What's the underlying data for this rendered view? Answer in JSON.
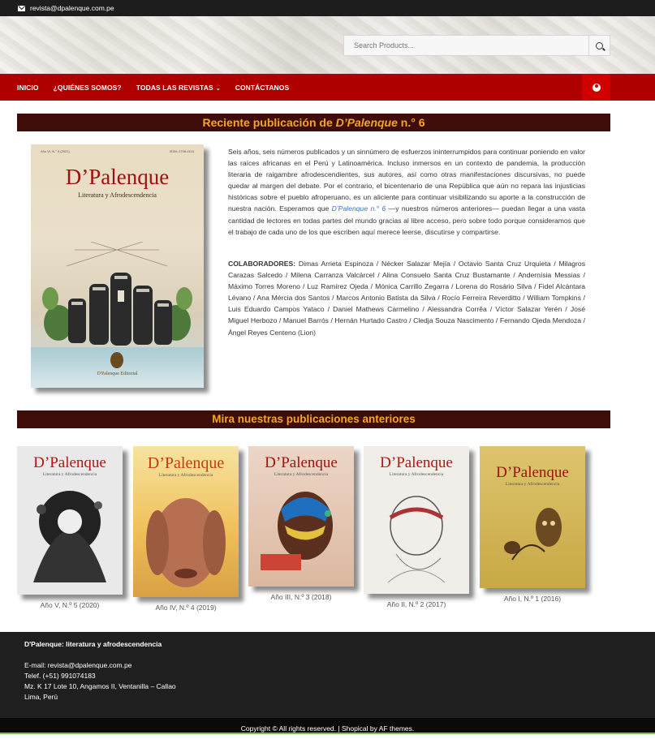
{
  "topbar": {
    "email": "revista@dpalenque.com.pe"
  },
  "search": {
    "placeholder": "Search Products..."
  },
  "nav": {
    "items": [
      "INICIO",
      "¿QUIÉNES SOMOS?",
      "TODAS LAS REVISTAS",
      "CONTÁCTANOS"
    ],
    "chevron": "⌄"
  },
  "recent": {
    "title_pre": "Reciente publicación de ",
    "title_em": "D’Palenque",
    "title_post": " n.° 6",
    "cover": {
      "issue": "Año VI, N.° 6 (2021)",
      "issn": "ISSN: 2708-4116",
      "name": "D’Palenque",
      "subtitle": "Literatura y Afrodescendencia",
      "publisher": "D'Palenque Editorial"
    },
    "description_1": "Seis años, seis números publicados y un sinnúmero de esfuerzos ininterrumpidos para continuar poniendo en valor las raíces africanas en el Perú y Latinoamérica. Incluso inmersos en un contexto de pandemia, la producción literaria de raigambre afrodescendientes, sus autores, así como otras manifestaciones discursivas, no puede quedar al margen del debate. Por el contrario, el bicentenario de una República que aún no repara las injusticias históricas sobre el pueblo afroperuano, es un aliciente para continuar visibilizando su aporte a la construcción de nuestra nación. Esperamos que ",
    "description_link": "D’Palenque n.° 6",
    "description_2": " —y nuestros números anteriores— puedan llegar a una vasta cantidad de lectores en todas partes del mundo gracias al libre acceso, pero sobre todo porque consideramos que el trabajo de cada uno de los que escriben aquí merece leerse, discutirse y compartirse.",
    "collab_label": "COLABORADORES:",
    "collab_text": " Dimas Arrieta Espinoza / Nécker Salazar Mejía / Octavio Santa Cruz Urquieta / Milagros Carazas Salcedo / Milena Carranza Valcárcel / Alina Consuelo Santa Cruz Bustamante / Andernísia Messias / Máximo Torres Moreno / Luz Ramírez Ojeda / Mónica Carrillo Zegarra / Lorena do Rosário Silva / Fidel Alcántara Lévano / Ana Mércia dos Santos / Marcos Antonio Batista da Silva / Rocío Ferreira Reverditto / William Tompkins / Luis Eduardo Campos Yataco / Daniel Mathews Carmelino / Alessandra Corrêa / Víctor Salazar Yerén / José Miguel Herbozo / Manuel Barrós / Hernán Hurtado Castro / Cledja Souza Nascimento / Fernando Ojeda Mendoza / Ángel Reyes Centeno (Lion)"
  },
  "previous": {
    "title": "Mira nuestras publicaciones anteriores",
    "issues": [
      {
        "caption": "Año V, N.º 5 (2020)",
        "name": "D’Palenque",
        "subtitle": "Literatura y Afrodescendencia",
        "bg": "#e9e9e9",
        "name_color": "#b81414"
      },
      {
        "caption": "Año IV, N.º 4 (2019)",
        "name": "D’Palenque",
        "subtitle": "Literatura y Afrodescendencia",
        "bg": "#f4d06f",
        "name_color": "#c63a16"
      },
      {
        "caption": "Año III, N.º 3 (2018)",
        "name": "D’Palenque",
        "subtitle": "Literatura y Afrodescendencia",
        "bg": "#e6c9b5",
        "name_color": "#a11313"
      },
      {
        "caption": "Año II, N.º 2 (2017)",
        "name": "D’Palenque",
        "subtitle": "Literatura y Afrodescendencia",
        "bg": "#f1ede8",
        "name_color": "#b81414"
      },
      {
        "caption": "Año I, N.º 1 (2016)",
        "name": "D’Palenque",
        "subtitle": "Literatura y Afrodescendencia",
        "bg": "#d9bf63",
        "name_color": "#9d1212"
      }
    ]
  },
  "footer": {
    "title": "D'Palenque: literatura y afrodescendencia",
    "email": "E-mail: revista@dpalenque.com.pe",
    "phone": "Telef. (+51) 991074183",
    "address": "Mz. K 17 Lote 10, Angamos II, Ventanilla – Callao",
    "city": "Lima, Perú",
    "copyright": "Copyright © All rights reserved. | Shopical by AF themes."
  }
}
